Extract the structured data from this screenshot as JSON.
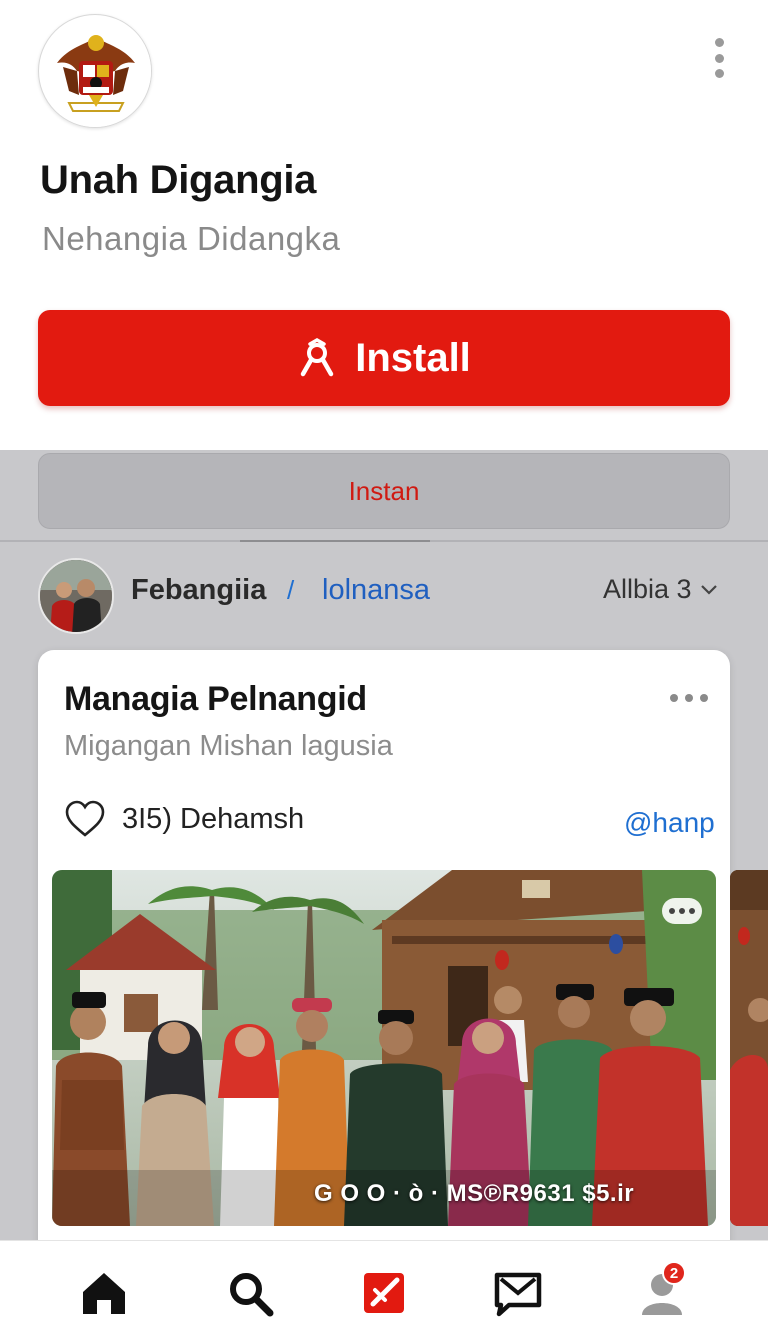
{
  "app": {
    "title": "Unah Digangia",
    "subtitle": "Nehangia Didangka",
    "install_label": "Install",
    "secondary_label": "Instan"
  },
  "feed_header": {
    "author": "Febangiia",
    "separator": "/",
    "author_link": "lolnansa",
    "sort_label": "Allbia 3"
  },
  "post": {
    "title": "Managia Pelnangid",
    "subtitle": "Migangan Mishan lagusia",
    "likes_text": "3I5) Dehamsh",
    "handle": "@hanp",
    "photo_caption": "G O O · ò · MS℗R9631 $5.ir"
  },
  "bottom_nav": {
    "items": [
      "home-icon",
      "search-icon",
      "create-icon",
      "messages-icon",
      "profile-icon"
    ],
    "profile_badge": "2"
  },
  "colors": {
    "accent": "#e21a10",
    "link": "#1f6fd1",
    "grey_bg": "#c8c8cb"
  }
}
